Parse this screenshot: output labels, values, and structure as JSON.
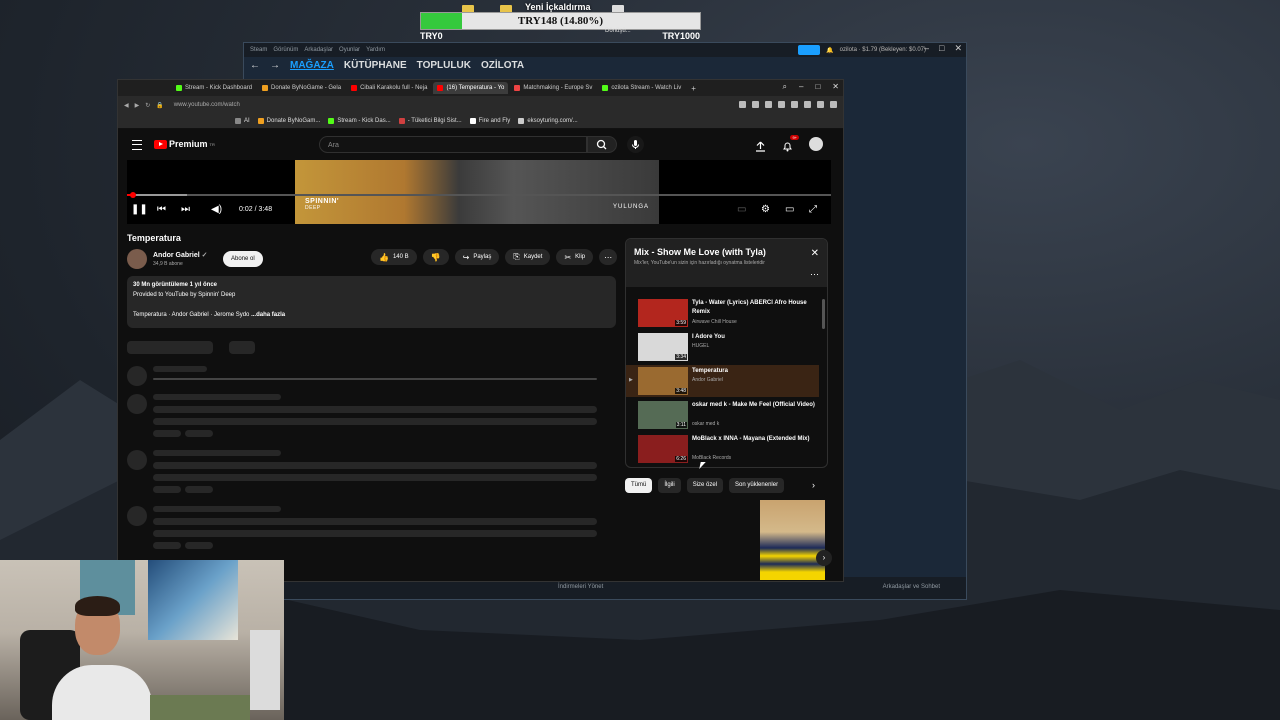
{
  "overlay": {
    "title": "Yeni İçkaldırma",
    "progress_percent": 14.8,
    "bar_text": "TRY148 (14.80%)",
    "left_label": "TRY0",
    "right_label": "TRY1000",
    "mid_label": "Dönüşü..."
  },
  "steam": {
    "menu": [
      "Steam",
      "Görünüm",
      "Arkadaşlar",
      "Oyunlar",
      "Yardım"
    ],
    "nav": [
      "MAĞAZA",
      "KÜTÜPHANE",
      "TOPLULUK",
      "OZİLOTA"
    ],
    "account": "ozilota · $1.79 (Bekleyen: $0.07)",
    "footer_center": "İndirmeleri Yönet",
    "footer_right": "Arkadaşlar ve Sohbet"
  },
  "browser": {
    "tabs": [
      {
        "label": "Stream - Kick Dashboard",
        "color": "#53fc18"
      },
      {
        "label": "Donate ByNoGame - Gela",
        "color": "#f0a020"
      },
      {
        "label": "Cibali Karakolu full - Neja",
        "color": "#ff0000"
      },
      {
        "label": "(16) Temperatura - Yo",
        "color": "#ff0000",
        "active": true
      },
      {
        "label": "Matchmaking - Europe Sv",
        "color": "#e44"
      },
      {
        "label": "ozilota Stream - Watch Liv",
        "color": "#53fc18"
      }
    ],
    "url": "www.youtube.com/watch",
    "bookmarks": [
      "AI",
      "Donate ByNoGam...",
      "Stream - Kick Das...",
      "- Tüketici Bilgi Sist...",
      "Fire and Fly",
      "eksoyturing.com/..."
    ]
  },
  "yt": {
    "logo_text": "Premium",
    "logo_sup": "TR",
    "search_placeholder": "Ara",
    "notif_badge": "9+",
    "player": {
      "time": "0:02 / 3:48",
      "progress_fraction": 0.009,
      "buffer_fraction": 0.085,
      "thumb_brand": "SPINNIN'",
      "thumb_sub": "DEEP",
      "thumb_right": "YULUNGA"
    },
    "video": {
      "title": "Temperatura",
      "channel": "Andor Gabriel",
      "subs": "34,9 B abone",
      "subscribe": "Abone ol",
      "likes": "140 B",
      "share": "Paylaş",
      "save": "Kaydet",
      "clip": "Klip"
    },
    "description": {
      "stats": "30 Mn görüntüleme  1 yıl önce",
      "line2": "Provided to YouTube by Spinnin' Deep",
      "line3": "Temperatura · Andor Gabriel · Jerome Sydo",
      "more": "...daha fazla"
    },
    "playlist": {
      "title": "Mix - Show Me Love (with Tyla)",
      "subtitle": "Mix'ler, YouTube'un sizin için hazırladığı oynatma listeleridir",
      "items": [
        {
          "name": "Tyla - Water (Lyrics) ABERCI Afro House Remix",
          "artist": "Airwave Chill House",
          "dur": "3:59",
          "color": "#b3261e"
        },
        {
          "name": "I Adore You",
          "artist": "HUGEL",
          "dur": "3:34",
          "color": "#d9d9d9"
        },
        {
          "name": "Temperatura",
          "artist": "Andor Gabriel",
          "dur": "3:48",
          "color": "#9a6a30",
          "active": true
        },
        {
          "name": "oskar med k - Make Me Feel (Official Video)",
          "artist": "oskar med k",
          "dur": "3:11",
          "color": "#556b55"
        },
        {
          "name": "MoBlack x INNA - Mayana (Extended Mix)",
          "artist": "MoBlack Records",
          "dur": "6:26",
          "color": "#8a1e1e"
        }
      ]
    },
    "chips": [
      {
        "label": "Tümü",
        "on": true
      },
      {
        "label": "İlgili"
      },
      {
        "label": "Size özel"
      },
      {
        "label": "Son yüklenenler"
      }
    ]
  }
}
